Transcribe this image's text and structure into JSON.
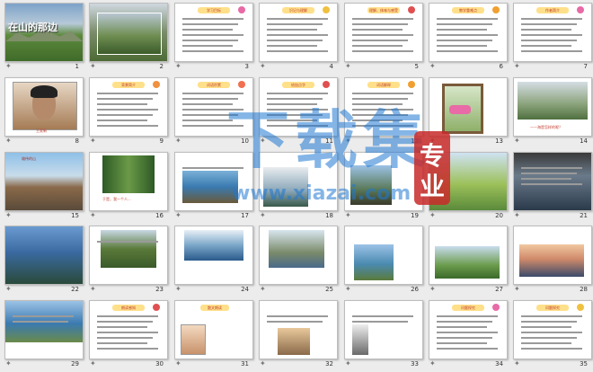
{
  "slides": [
    {
      "n": "1",
      "kind": "title",
      "t1": "在山的那边",
      "bg": "#5a8d3c"
    },
    {
      "n": "2",
      "kind": "mountain"
    },
    {
      "n": "3",
      "kind": "text",
      "hdr": "学习目标",
      "flower": "#e86aa6"
    },
    {
      "n": "4",
      "kind": "text",
      "hdr": "识记与理解",
      "flower": "#f0c040"
    },
    {
      "n": "5",
      "kind": "text",
      "hdr": "理解、体味与感受",
      "flower": "#e05050"
    },
    {
      "n": "6",
      "kind": "text",
      "hdr": "教学重难点",
      "flower": "#f0a030"
    },
    {
      "n": "7",
      "kind": "text",
      "hdr": "作者简介",
      "flower": "#e86aa6"
    },
    {
      "n": "8",
      "kind": "portrait",
      "cap": "王家新"
    },
    {
      "n": "9",
      "kind": "text",
      "hdr": "背景简介",
      "flower": "#f09040"
    },
    {
      "n": "10",
      "kind": "text",
      "hdr": "词语积累",
      "flower": "#f07050"
    },
    {
      "n": "11",
      "kind": "text",
      "hdr": "给加点字",
      "flower": "#e05050"
    },
    {
      "n": "12",
      "kind": "text",
      "hdr": "词语解释",
      "flower": "#f0a030"
    },
    {
      "n": "13",
      "kind": "window"
    },
    {
      "n": "14",
      "kind": "valley",
      "cap": "——海是怎样的呢？"
    },
    {
      "n": "15",
      "kind": "rock",
      "cap": "雄伟的山"
    },
    {
      "n": "16",
      "kind": "trees",
      "cap": "于是，我一个人..."
    },
    {
      "n": "17",
      "kind": "rockyshore"
    },
    {
      "n": "18",
      "kind": "mist"
    },
    {
      "n": "19",
      "kind": "lighthouse"
    },
    {
      "n": "20",
      "kind": "greenslope"
    },
    {
      "n": "21",
      "kind": "dark"
    },
    {
      "n": "22",
      "kind": "bluemountain"
    },
    {
      "n": "23",
      "kind": "ridge"
    },
    {
      "n": "24",
      "kind": "waves"
    },
    {
      "n": "25",
      "kind": "island"
    },
    {
      "n": "26",
      "kind": "bay"
    },
    {
      "n": "27",
      "kind": "hills"
    },
    {
      "n": "28",
      "kind": "sunset"
    },
    {
      "n": "29",
      "kind": "coast"
    },
    {
      "n": "30",
      "kind": "text",
      "hdr": "朗读感知",
      "flower": "#e05050"
    },
    {
      "n": "31",
      "kind": "girl",
      "hdr": "散文朗读"
    },
    {
      "n": "32",
      "kind": "cliff"
    },
    {
      "n": "33",
      "kind": "statue"
    },
    {
      "n": "34",
      "kind": "text",
      "hdr": "问题探究",
      "flower": "#e86aa6"
    },
    {
      "n": "35",
      "kind": "text",
      "hdr": "问题探究",
      "flower": "#f0c040"
    }
  ],
  "watermark": {
    "main": "下载集",
    "url": "www.xiazai.com",
    "seal": "专业"
  },
  "colors": {
    "sea": "#3a7ab0",
    "sky": "#9cc2e6",
    "green": "#4e8a3a",
    "wm": "#1f78d2",
    "seal": "#c82a2a"
  }
}
